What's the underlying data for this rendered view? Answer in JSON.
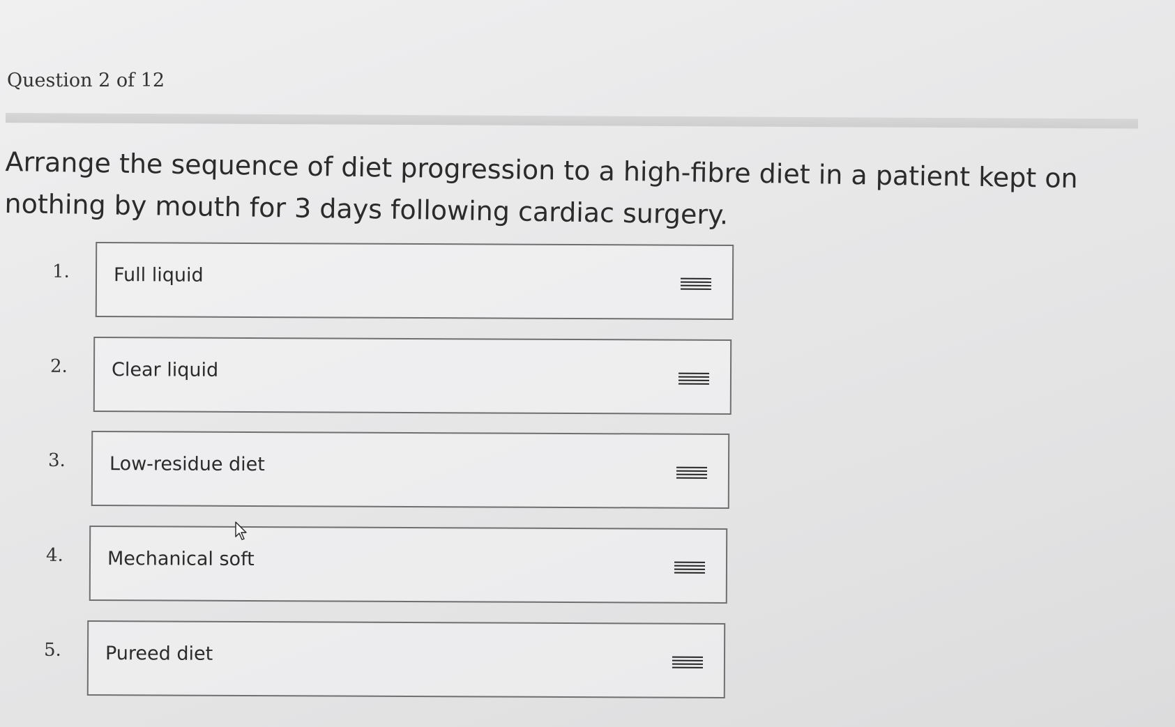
{
  "question": {
    "counter": "Question 2 of 12",
    "prompt": "Arrange the sequence of diet progression to a high-fibre diet in a patient kept on nothing by mouth for 3 days following cardiac surgery."
  },
  "items": [
    {
      "number": "1.",
      "label": "Full liquid"
    },
    {
      "number": "2.",
      "label": "Clear liquid"
    },
    {
      "number": "3.",
      "label": "Low-residue diet"
    },
    {
      "number": "4.",
      "label": "Mechanical soft"
    },
    {
      "number": "5.",
      "label": "Pureed diet"
    }
  ],
  "icons": {
    "drag_handle": "drag-handle-icon",
    "cursor": "mouse-pointer-icon"
  },
  "colors": {
    "background": "#e8e8e9",
    "box_border": "#6f6f70",
    "text": "#2b2b2b"
  }
}
